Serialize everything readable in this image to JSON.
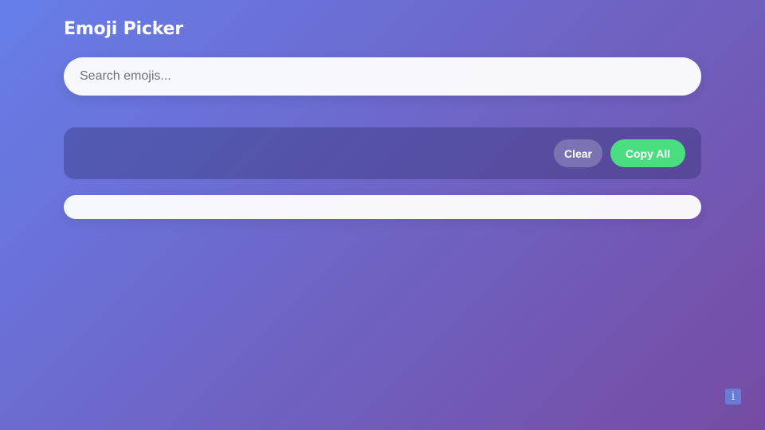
{
  "app": {
    "title": "Emoji Picker"
  },
  "search": {
    "placeholder": "Search emojis...",
    "value": ""
  },
  "selection_bar": {
    "clear_label": "Clear",
    "copy_all_label": "Copy All"
  },
  "colors": {
    "background_start": "#667eea",
    "background_end": "#764ba2",
    "copy_button": "#4ade80"
  },
  "info": {
    "icon": "info-icon",
    "glyph": "i"
  }
}
